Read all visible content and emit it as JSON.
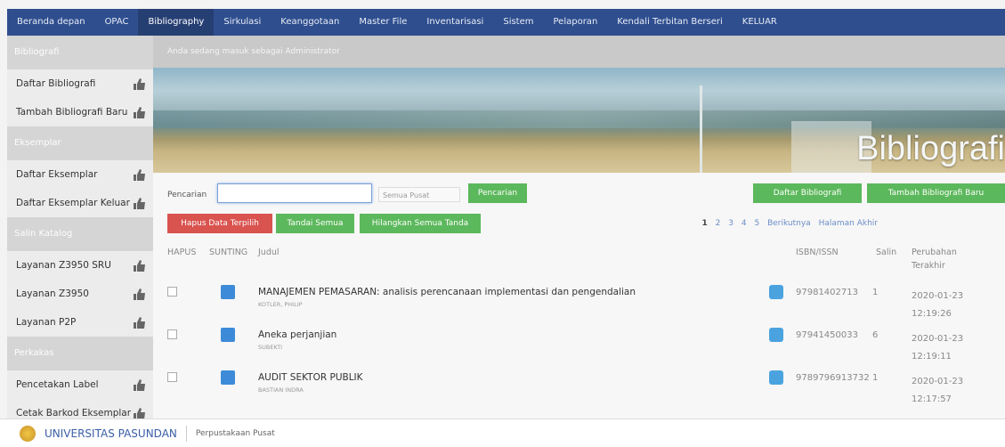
{
  "nav": {
    "items": [
      "Beranda depan",
      "OPAC",
      "Bibliography",
      "Sirkulasi",
      "Keanggotaan",
      "Master File",
      "Inventarisasi",
      "Sistem",
      "Pelaporan",
      "Kendali Terbitan Berseri",
      "KELUAR"
    ],
    "active": "Bibliography"
  },
  "sidebar": {
    "section1": "Bibliografi",
    "item_daftar_bibliografi": "Daftar Bibliografi",
    "item_tambah_bibliografi": "Tambah Bibliografi Baru",
    "section2": "Eksemplar",
    "item_daftar_eksemplar": "Daftar Eksemplar",
    "item_daftar_eksemplar_keluar": "Daftar Eksemplar Keluar",
    "section3": "Salin Katalog",
    "item_z3950_sru": "Layanan Z3950 SRU",
    "item_z3950": "Layanan Z3950",
    "item_p2p": "Layanan P2P",
    "section4": "Perkakas",
    "item_label": "Pencetakan Label",
    "item_barcode": "Cetak Barkod Eksemplar"
  },
  "main": {
    "breadcrumb": "Anda sedang masuk sebagai Administrator",
    "banner_title": "Bibliografi",
    "search_label": "Pencarian",
    "search_value": "",
    "search_scope": "Semua Pusat",
    "search_button": "Pencarian",
    "list_button": "Daftar Bibliografi",
    "add_button": "Tambah Bibliografi Baru",
    "delete_button": "Hapus Data Terpilih",
    "mark_all_button": "Tandai Semua",
    "unmark_all_button": "Hilangkan Semua Tanda",
    "pager": {
      "pages": [
        "1",
        "2",
        "3",
        "4",
        "5"
      ],
      "next": "Berikutnya",
      "last": "Halaman Akhir"
    },
    "columns": {
      "delete": "HAPUS",
      "edit": "SUNTING",
      "title": "Judul",
      "isbn": "ISBN/ISSN",
      "copies": "Salin",
      "updated_line1": "Perubahan",
      "updated_line2": "Terakhir"
    },
    "rows": [
      {
        "title": "MANAJEMEN PEMASARAN: analisis perencanaan implementasi dan pengendalian",
        "author": "KOTLER, PHILIP",
        "isbn": "97981402713",
        "copies": "1",
        "date": "2020-01-23",
        "time": "12:19:26"
      },
      {
        "title": "Aneka perjanjian",
        "author": "SUBEKTI",
        "isbn": "97941450033",
        "copies": "6",
        "date": "2020-01-23",
        "time": "12:19:11"
      },
      {
        "title": "AUDIT SEKTOR PUBLIK",
        "author": "BASTIAN INDRA",
        "isbn": "9789796913732",
        "copies": "1",
        "date": "2020-01-23",
        "time": "12:17:57"
      }
    ]
  },
  "footer": {
    "university": "UNIVERSITAS PASUNDAN",
    "library": "Perpustakaan Pusat"
  },
  "colors": {
    "nav": "#2e4e8e",
    "green": "#5cb85c",
    "red": "#d9534f",
    "link": "#6a8dc8"
  }
}
